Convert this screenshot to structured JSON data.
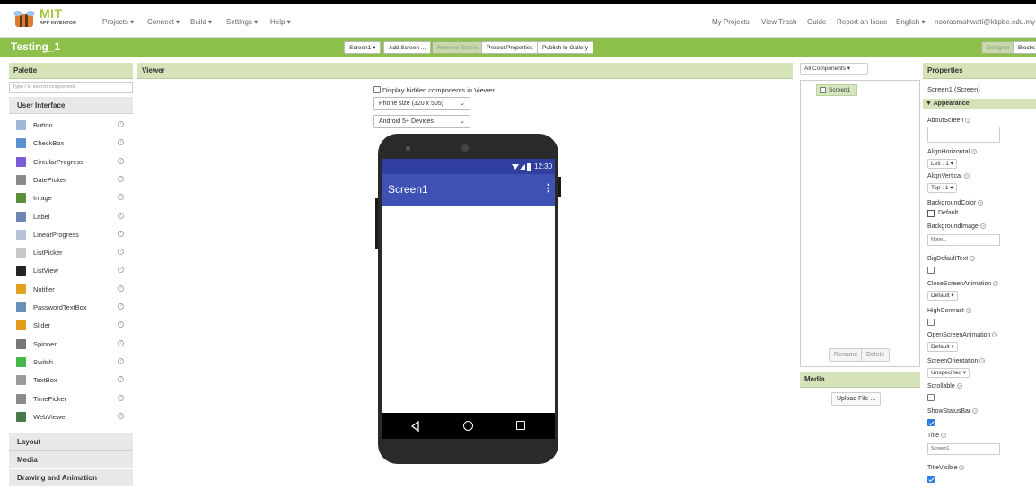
{
  "topbar": {
    "brand_top": "MIT",
    "brand_bottom": "APP INVENTOR",
    "menus": [
      "Projects ▾",
      "Connect ▾",
      "Build ▾",
      "Settings ▾",
      "Help ▾"
    ],
    "right_links": [
      "My Projects",
      "View Trash",
      "Guide",
      "Report an Issue",
      "English ▾",
      "noorasmahwati@kkpbe.edu.my"
    ]
  },
  "projectbar": {
    "name": "Testing_1",
    "screen_btn": "Screen1 ▾",
    "add_screen": "Add Screen ...",
    "remove_screen": "Remove Screen",
    "project_props": "Project Properties",
    "publish": "Publish to Gallery",
    "designer": "Designer",
    "blocks": "Blocks"
  },
  "palette": {
    "title": "Palette",
    "search_placeholder": "Type / to search components",
    "categories": [
      "User Interface",
      "Layout",
      "Media",
      "Drawing and Animation"
    ],
    "items": [
      {
        "label": "Button",
        "icon": "button-icon",
        "color": "#9fb8d8"
      },
      {
        "label": "CheckBox",
        "icon": "checkbox-icon",
        "color": "#5a8fd0"
      },
      {
        "label": "CircularProgress",
        "icon": "circular-progress-icon",
        "color": "#7b5bd6"
      },
      {
        "label": "DatePicker",
        "icon": "date-picker-icon",
        "color": "#8a8a8a"
      },
      {
        "label": "Image",
        "icon": "image-icon",
        "color": "#5b8e3a"
      },
      {
        "label": "Label",
        "icon": "label-icon",
        "color": "#6b85b5"
      },
      {
        "label": "LinearProgress",
        "icon": "linear-progress-icon",
        "color": "#b5c3d8"
      },
      {
        "label": "ListPicker",
        "icon": "list-picker-icon",
        "color": "#c8c8c8"
      },
      {
        "label": "ListView",
        "icon": "list-view-icon",
        "color": "#222222"
      },
      {
        "label": "Notifier",
        "icon": "notifier-icon",
        "color": "#e0a21e"
      },
      {
        "label": "PasswordTextBox",
        "icon": "password-textbox-icon",
        "color": "#6a8fb8"
      },
      {
        "label": "Slider",
        "icon": "slider-icon",
        "color": "#e39a1a"
      },
      {
        "label": "Spinner",
        "icon": "spinner-icon",
        "color": "#777777"
      },
      {
        "label": "Switch",
        "icon": "switch-icon",
        "color": "#46b84a"
      },
      {
        "label": "TextBox",
        "icon": "textbox-icon",
        "color": "#9a9a9a"
      },
      {
        "label": "TimePicker",
        "icon": "time-picker-icon",
        "color": "#8a8a8a"
      },
      {
        "label": "WebViewer",
        "icon": "webviewer-icon",
        "color": "#4a7a4a"
      }
    ],
    "help": "?"
  },
  "viewer": {
    "title": "Viewer",
    "hidden_label": "Display hidden components in Viewer",
    "size_option": "Phone size (320 x 505)",
    "device_option": "Android 5+ Devices",
    "time": "12:30",
    "screen_title": "Screen1"
  },
  "components": {
    "title": "All Components ▾",
    "screen": "Screen1",
    "rename": "Rename",
    "delete": "Delete",
    "media_title": "Media",
    "upload": "Upload File ..."
  },
  "properties": {
    "title": "Properties",
    "subtitle": "Screen1 (Screen)",
    "section": "▼ Appearance",
    "about": "AboutScreen",
    "align_h": "AlignHorizontal",
    "align_h_val": "Left : 1 ▾",
    "align_v": "AlignVertical",
    "align_v_val": "Top : 1 ▾",
    "bgcolor": "BackgroundColor",
    "bgcolor_val": "Default",
    "bgimage": "BackgroundImage",
    "bgimage_val": "None...",
    "bigtext": "BigDefaultText",
    "close_anim": "CloseScreenAnimation",
    "close_anim_val": "Default ▾",
    "highcontrast": "HighContrast",
    "open_anim": "OpenScreenAnimation",
    "open_anim_val": "Default ▾",
    "orientation": "ScreenOrientation",
    "orientation_val": "Unspecified ▾",
    "scrollable": "Scrollable",
    "statusbar": "ShowStatusBar",
    "title_lbl": "Title",
    "title_val": "Screen1",
    "titlevisible": "TitleVisible",
    "help": "?"
  }
}
